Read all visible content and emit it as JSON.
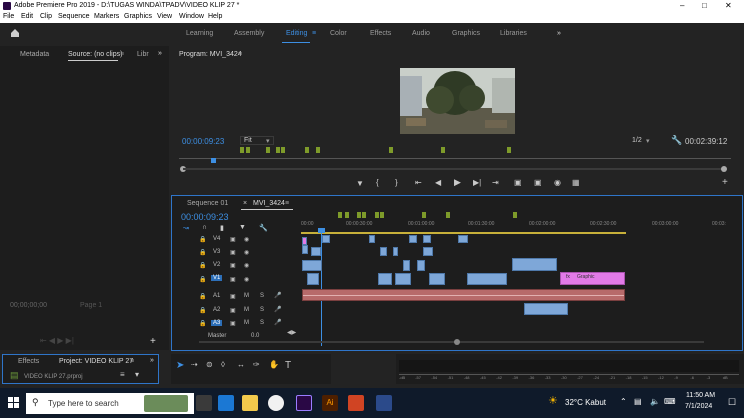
{
  "titlebar": {
    "title": "Adobe Premiere Pro 2019 - D:\\TUGAS WINDA\\TPADV\\VIDEO KLIP 27 *",
    "min": "–",
    "max": "□",
    "close": "✕"
  },
  "menu": [
    "File",
    "Edit",
    "Clip",
    "Sequence",
    "Markers",
    "Graphics",
    "View",
    "Window",
    "Help"
  ],
  "workspaces": [
    "Learning",
    "Assembly",
    "Editing",
    "Color",
    "Effects",
    "Audio",
    "Graphics",
    "Libraries"
  ],
  "workspace_more": "»",
  "source_panel": {
    "tabs": [
      "Metadata",
      "Source: (no clips)",
      "Libr"
    ],
    "more": "»",
    "timecode": "00;00;00;00",
    "page": "Page 1"
  },
  "program": {
    "title": "Program: MVI_3424",
    "timecode": "00:00:09:23",
    "fit": "Fit",
    "resolution": "1/2",
    "duration": "00:02:39:12"
  },
  "timeline": {
    "tabs": [
      "Sequence 01",
      "MVI_3424"
    ],
    "close": "×",
    "timecode": "00:00:09:23",
    "ruler": [
      "00:00",
      "00:00:30:00",
      "00:01:00:00",
      "00:01:30:00",
      "00:02:00:00",
      "00:02:30:00",
      "00:03:00:00",
      "00:03:"
    ],
    "video_tracks": [
      "V4",
      "V3",
      "V2",
      "V1"
    ],
    "audio_tracks": [
      "A1",
      "A2",
      "A3"
    ],
    "master": "Master",
    "master_val": "0.0",
    "graphic_label": "Graphic",
    "fx": "fx"
  },
  "project_panel": {
    "tabs": [
      "Effects",
      "Project: VIDEO KLIP 27"
    ],
    "file": "VIDEO KLIP 27.prproj",
    "more": "»"
  },
  "meter": {
    "labels": [
      "-dB",
      "-57",
      "-54",
      "-51",
      "-48",
      "-45",
      "-42",
      "-39",
      "-36",
      "-33",
      "-30",
      "-27",
      "-24",
      "-21",
      "-18",
      "-15",
      "-12",
      "-9",
      "-6",
      "-3",
      "dB"
    ]
  },
  "taskbar": {
    "search": "Type here to search",
    "weather": "32°C Kabut",
    "time": "11:50 AM",
    "date": "7/1/2024"
  },
  "colors": {
    "accent": "#3d8fe3",
    "clip_video": "#7ea7d8",
    "clip_graphic": "#e27ae7",
    "audio_clip": "#b76a6a",
    "marker": "#7e9b2a"
  }
}
